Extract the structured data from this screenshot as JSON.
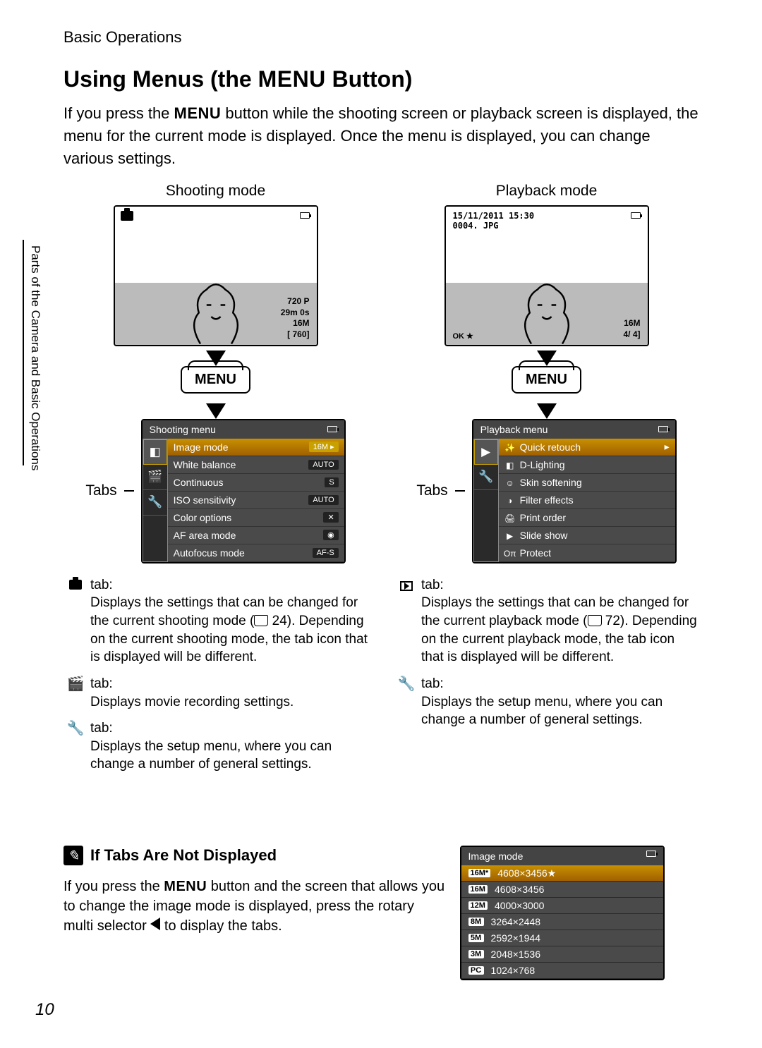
{
  "breadcrumb": "Basic Operations",
  "title_before": "Using Menus (the ",
  "title_menu": "MENU",
  "title_after": " Button)",
  "intro_before": "If you press the ",
  "intro_menu": "MENU",
  "intro_after": " button while the shooting screen or playback screen is displayed, the menu for the current mode is displayed. Once the menu is displayed, you can change various settings.",
  "side_label": "Parts of the Camera and Basic Operations",
  "shooting": {
    "label": "Shooting mode",
    "tabs_label": "Tabs",
    "overlay_movie": "720 P",
    "overlay_time": "29m 0s",
    "overlay_quality": "16M",
    "overlay_shots": "[   760]",
    "menu_button": "MENU",
    "menu_title": "Shooting menu",
    "items": [
      {
        "name": "Image mode",
        "value": "16M",
        "hl": true
      },
      {
        "name": "White balance",
        "value": "AUTO"
      },
      {
        "name": "Continuous",
        "value": "S"
      },
      {
        "name": "ISO sensitivity",
        "value": "AUTO"
      },
      {
        "name": "Color options",
        "value": "✕"
      },
      {
        "name": "AF area mode",
        "value": "◉"
      },
      {
        "name": "Autofocus mode",
        "value": "AF-S"
      }
    ],
    "desc": [
      {
        "icon_name": "camera-icon",
        "label": " tab:",
        "body_before": "Displays the settings that can be changed for the current shooting mode (",
        "ref": "24",
        "body_after": "). Depending on the current shooting mode, the tab icon that is displayed will be different."
      },
      {
        "icon_name": "movie-icon",
        "label": " tab:",
        "body": "Displays movie recording settings."
      },
      {
        "icon_name": "wrench-icon",
        "label": " tab:",
        "body": "Displays the setup menu, where you can change a number of general settings."
      }
    ]
  },
  "playback": {
    "label": "Playback mode",
    "tabs_label": "Tabs",
    "overlay_date": "15/11/2011 15:30",
    "overlay_file": "0004. JPG",
    "overlay_quality": "16M",
    "overlay_count": "4/      4]",
    "overlay_ok": "OK ★",
    "menu_button": "MENU",
    "menu_title": "Playback menu",
    "items": [
      {
        "name": "Quick retouch",
        "icon": "✨",
        "hl": true
      },
      {
        "name": "D-Lighting",
        "icon": "◧"
      },
      {
        "name": "Skin softening",
        "icon": "☺"
      },
      {
        "name": "Filter effects",
        "icon": "◑"
      },
      {
        "name": "Print order",
        "icon": "🖨"
      },
      {
        "name": "Slide show",
        "icon": "▶"
      },
      {
        "name": "Protect",
        "icon": "Oπ"
      }
    ],
    "desc": [
      {
        "icon_name": "playback-icon",
        "label": "tab:",
        "body_before": "Displays the settings that can be changed for the current playback mode (",
        "ref": "72",
        "body_after": "). Depending on the current playback mode, the tab icon that is displayed will be different."
      },
      {
        "icon_name": "wrench-icon",
        "label": " tab:",
        "body": "Displays the setup menu, where you can change a number of general settings."
      }
    ]
  },
  "note": {
    "title": "If Tabs Are Not Displayed",
    "body_before": "If you press the ",
    "body_menu": "MENU",
    "body_mid": " button and the screen that allows you to change the image mode is displayed, press the rotary multi selector ",
    "body_after": " to display the tabs."
  },
  "image_mode_panel": {
    "title": "Image mode",
    "rows": [
      {
        "badge": "16M*",
        "value": "4608×3456★",
        "hl": true
      },
      {
        "badge": "16M",
        "value": "4608×3456"
      },
      {
        "badge": "12M",
        "value": "4000×3000"
      },
      {
        "badge": "8M",
        "value": "3264×2448"
      },
      {
        "badge": "5M",
        "value": "2592×1944"
      },
      {
        "badge": "3M",
        "value": "2048×1536"
      },
      {
        "badge": "PC",
        "value": "1024×768"
      }
    ]
  },
  "page_number": "10"
}
